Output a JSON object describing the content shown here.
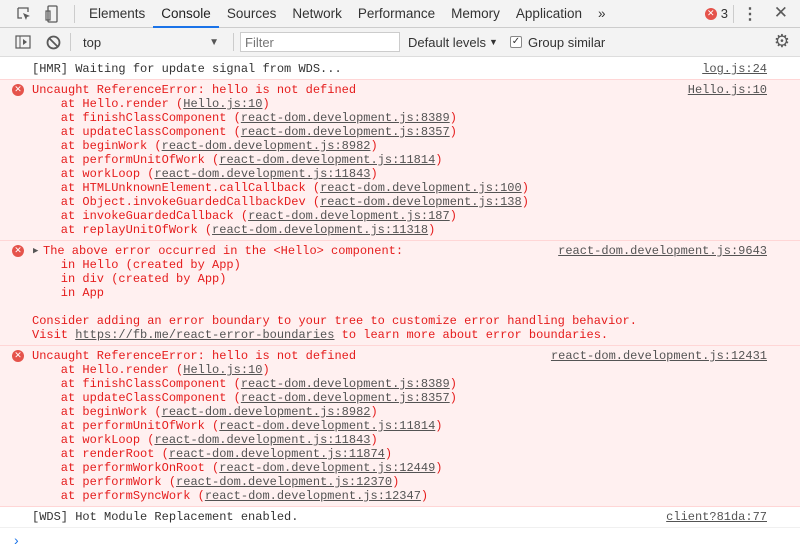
{
  "tabs": [
    "Elements",
    "Console",
    "Sources",
    "Network",
    "Performance",
    "Memory",
    "Application"
  ],
  "active_tab": "Console",
  "more_tabs": "»",
  "error_count": "3",
  "toolbar": {
    "context": "top",
    "filter_placeholder": "Filter",
    "levels": "Default levels",
    "group_similar": "Group similar",
    "group_similar_checked": true
  },
  "messages": {
    "hmr": {
      "text": "[HMR] Waiting for update signal from WDS...",
      "source": "log.js:24"
    },
    "err1": {
      "text": "Uncaught ReferenceError: hello is not defined",
      "source": "Hello.js:10",
      "stack": [
        {
          "fn": "Hello.render",
          "loc": "Hello.js:10"
        },
        {
          "fn": "finishClassComponent",
          "loc": "react-dom.development.js:8389"
        },
        {
          "fn": "updateClassComponent",
          "loc": "react-dom.development.js:8357"
        },
        {
          "fn": "beginWork",
          "loc": "react-dom.development.js:8982"
        },
        {
          "fn": "performUnitOfWork",
          "loc": "react-dom.development.js:11814"
        },
        {
          "fn": "workLoop",
          "loc": "react-dom.development.js:11843"
        },
        {
          "fn": "HTMLUnknownElement.callCallback",
          "loc": "react-dom.development.js:100"
        },
        {
          "fn": "Object.invokeGuardedCallbackDev",
          "loc": "react-dom.development.js:138"
        },
        {
          "fn": "invokeGuardedCallback",
          "loc": "react-dom.development.js:187"
        },
        {
          "fn": "replayUnitOfWork",
          "loc": "react-dom.development.js:11318"
        }
      ]
    },
    "err2": {
      "text": "The above error occurred in the <Hello> component:",
      "source": "react-dom.development.js:9643",
      "lines": [
        "    in Hello (created by App)",
        "    in div (created by App)",
        "    in App"
      ],
      "consider": "Consider adding an error boundary to your tree to customize error handling behavior.",
      "visit_pre": "Visit ",
      "visit_link": "https://fb.me/react-error-boundaries",
      "visit_post": " to learn more about error boundaries."
    },
    "err3": {
      "text": "Uncaught ReferenceError: hello is not defined",
      "source": "react-dom.development.js:12431",
      "stack": [
        {
          "fn": "Hello.render",
          "loc": "Hello.js:10"
        },
        {
          "fn": "finishClassComponent",
          "loc": "react-dom.development.js:8389"
        },
        {
          "fn": "updateClassComponent",
          "loc": "react-dom.development.js:8357"
        },
        {
          "fn": "beginWork",
          "loc": "react-dom.development.js:8982"
        },
        {
          "fn": "performUnitOfWork",
          "loc": "react-dom.development.js:11814"
        },
        {
          "fn": "workLoop",
          "loc": "react-dom.development.js:11843"
        },
        {
          "fn": "renderRoot",
          "loc": "react-dom.development.js:11874"
        },
        {
          "fn": "performWorkOnRoot",
          "loc": "react-dom.development.js:12449"
        },
        {
          "fn": "performWork",
          "loc": "react-dom.development.js:12370"
        },
        {
          "fn": "performSyncWork",
          "loc": "react-dom.development.js:12347"
        }
      ]
    },
    "wds": {
      "text": "[WDS] Hot Module Replacement enabled.",
      "source": "client?81da:77"
    }
  },
  "prompt": "›"
}
